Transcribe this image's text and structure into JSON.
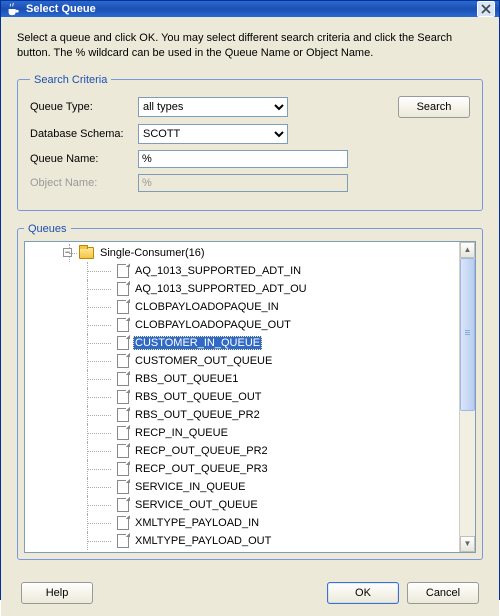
{
  "window": {
    "title": "Select Queue"
  },
  "instructions": "Select a queue and click OK. You may select different search criteria and click the Search button. The % wildcard can be used in the Queue Name or Object Name.",
  "search_criteria": {
    "legend": "Search Criteria",
    "queue_type_label": "Queue Type:",
    "queue_type_value": "all types",
    "queue_type_options": [
      "all types"
    ],
    "db_schema_label": "Database Schema:",
    "db_schema_value": "SCOTT",
    "db_schema_options": [
      "SCOTT"
    ],
    "queue_name_label": "Queue Name:",
    "queue_name_value": "%",
    "object_name_label": "Object Name:",
    "object_name_value": "%",
    "search_button": "Search"
  },
  "queues": {
    "legend": "Queues",
    "parent_label": "Single-Consumer(16)",
    "selected": "CUSTOMER_IN_QUEUE",
    "items": [
      "AQ_1013_SUPPORTED_ADT_IN",
      "AQ_1013_SUPPORTED_ADT_OU",
      "CLOBPAYLOADOPAQUE_IN",
      "CLOBPAYLOADOPAQUE_OUT",
      "CUSTOMER_IN_QUEUE",
      "CUSTOMER_OUT_QUEUE",
      "RBS_OUT_QUEUE1",
      "RBS_OUT_QUEUE_OUT",
      "RBS_OUT_QUEUE_PR2",
      "RECP_IN_QUEUE",
      "RECP_OUT_QUEUE_PR2",
      "RECP_OUT_QUEUE_PR3",
      "SERVICE_IN_QUEUE",
      "SERVICE_OUT_QUEUE",
      "XMLTYPE_PAYLOAD_IN",
      "XMLTYPE_PAYLOAD_OUT"
    ]
  },
  "buttons": {
    "help": "Help",
    "ok": "OK",
    "cancel": "Cancel"
  }
}
